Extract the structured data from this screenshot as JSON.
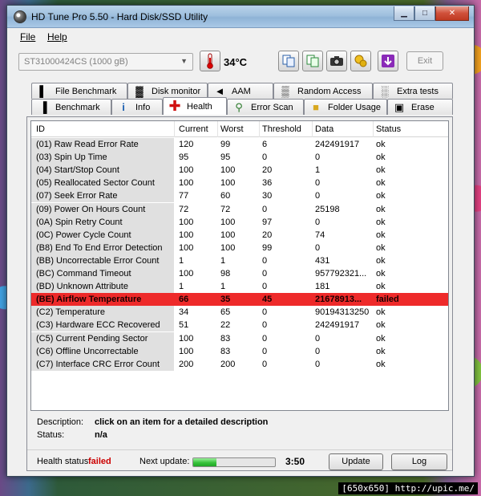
{
  "window": {
    "title": "HD Tune Pro 5.50 - Hard Disk/SSD Utility"
  },
  "menu": {
    "file": "File",
    "help": "Help"
  },
  "toolbar": {
    "drive": "ST31000424CS (1000 gB)",
    "temperature": "34°C",
    "exit_label": "Exit"
  },
  "tabs": {
    "top": [
      "File Benchmark",
      "Disk monitor",
      "AAM",
      "Random Access",
      "Extra tests"
    ],
    "bottom": [
      "Benchmark",
      "Info",
      "Health",
      "Error Scan",
      "Folder Usage",
      "Erase"
    ],
    "active": "Health"
  },
  "table": {
    "columns": [
      "ID",
      "Current",
      "Worst",
      "Threshold",
      "Data",
      "Status"
    ],
    "rows": [
      {
        "id": "(01) Raw Read Error Rate",
        "current": "120",
        "worst": "99",
        "threshold": "6",
        "data": "242491917",
        "status": "ok"
      },
      {
        "id": "(03) Spin Up Time",
        "current": "95",
        "worst": "95",
        "threshold": "0",
        "data": "0",
        "status": "ok"
      },
      {
        "id": "(04) Start/Stop Count",
        "current": "100",
        "worst": "100",
        "threshold": "20",
        "data": "1",
        "status": "ok"
      },
      {
        "id": "(05) Reallocated Sector Count",
        "current": "100",
        "worst": "100",
        "threshold": "36",
        "data": "0",
        "status": "ok"
      },
      {
        "id": "(07) Seek Error Rate",
        "current": "77",
        "worst": "60",
        "threshold": "30",
        "data": "0",
        "status": "ok"
      },
      {
        "id": "(09) Power On Hours Count",
        "current": "72",
        "worst": "72",
        "threshold": "0",
        "data": "25198",
        "status": "ok"
      },
      {
        "id": "(0A) Spin Retry Count",
        "current": "100",
        "worst": "100",
        "threshold": "97",
        "data": "0",
        "status": "ok"
      },
      {
        "id": "(0C) Power Cycle Count",
        "current": "100",
        "worst": "100",
        "threshold": "20",
        "data": "74",
        "status": "ok"
      },
      {
        "id": "(B8) End To End Error Detection",
        "current": "100",
        "worst": "100",
        "threshold": "99",
        "data": "0",
        "status": "ok"
      },
      {
        "id": "(BB) Uncorrectable Error Count",
        "current": "1",
        "worst": "1",
        "threshold": "0",
        "data": "431",
        "status": "ok"
      },
      {
        "id": "(BC) Command Timeout",
        "current": "100",
        "worst": "98",
        "threshold": "0",
        "data": "957792321...",
        "status": "ok"
      },
      {
        "id": "(BD) Unknown Attribute",
        "current": "1",
        "worst": "1",
        "threshold": "0",
        "data": "181",
        "status": "ok"
      },
      {
        "id": "(BE) Airflow Temperature",
        "current": "66",
        "worst": "35",
        "threshold": "45",
        "data": "21678913...",
        "status": "failed"
      },
      {
        "id": "(C2) Temperature",
        "current": "34",
        "worst": "65",
        "threshold": "0",
        "data": "90194313250",
        "status": "ok"
      },
      {
        "id": "(C3) Hardware ECC Recovered",
        "current": "51",
        "worst": "22",
        "threshold": "0",
        "data": "242491917",
        "status": "ok"
      },
      {
        "id": "(C5) Current Pending Sector",
        "current": "100",
        "worst": "83",
        "threshold": "0",
        "data": "0",
        "status": "ok"
      },
      {
        "id": "(C6) Offline Uncorrectable",
        "current": "100",
        "worst": "83",
        "threshold": "0",
        "data": "0",
        "status": "ok"
      },
      {
        "id": "(C7) Interface CRC Error Count",
        "current": "200",
        "worst": "200",
        "threshold": "0",
        "data": "0",
        "status": "ok"
      }
    ]
  },
  "description": {
    "label": "Description:",
    "value": "click on an item for a detailed description",
    "status_label": "Status:",
    "status_value": "n/a"
  },
  "footer": {
    "health_label": "Health status:",
    "health_value": "failed",
    "next_update_label": "Next update:",
    "progress_fraction": 0.28,
    "countdown": "3:50",
    "update_label": "Update",
    "log_label": "Log"
  },
  "watermark": "[650x650] http://upic.me/",
  "colors": {
    "failed_row": "#ee2a2a",
    "failed_text": "#cc0000",
    "progress": "#37c23a"
  }
}
